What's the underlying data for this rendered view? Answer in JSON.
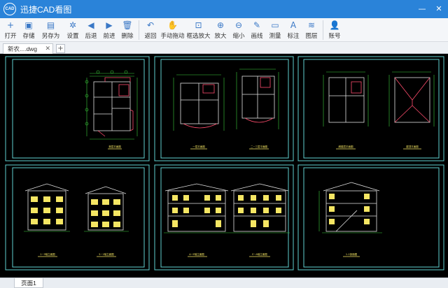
{
  "app": {
    "logo_text": "CAD",
    "title": "迅捷CAD看图"
  },
  "window_controls": {
    "minimize": "—",
    "close": "✕"
  },
  "toolbar": [
    {
      "id": "open",
      "label": "打开",
      "icon": "plus-icon",
      "glyph": "+"
    },
    {
      "id": "save",
      "label": "存储",
      "icon": "save-icon",
      "glyph": "▣"
    },
    {
      "id": "saveas",
      "label": "另存为",
      "icon": "save-as-icon",
      "glyph": "▤"
    },
    {
      "id": "settings",
      "label": "设置",
      "icon": "gear-icon",
      "glyph": "✲"
    },
    {
      "id": "back",
      "label": "后退",
      "icon": "back-arrow-icon",
      "glyph": "◀"
    },
    {
      "id": "forward",
      "label": "前进",
      "icon": "forward-arrow-icon",
      "glyph": "▶"
    },
    {
      "id": "delete",
      "label": "删除",
      "icon": "trash-icon",
      "glyph": "🗑"
    },
    {
      "id": "return",
      "label": "返回",
      "icon": "return-icon",
      "glyph": "↶"
    },
    {
      "id": "pan",
      "label": "手动拖动",
      "icon": "hand-icon",
      "glyph": "✋"
    },
    {
      "id": "zoomwin",
      "label": "框选放大",
      "icon": "zoom-window-icon",
      "glyph": "⊡"
    },
    {
      "id": "zoomin",
      "label": "放大",
      "icon": "zoom-in-icon",
      "glyph": "⊕"
    },
    {
      "id": "zoomout",
      "label": "缩小",
      "icon": "zoom-out-icon",
      "glyph": "⊖"
    },
    {
      "id": "line",
      "label": "画线",
      "icon": "pencil-icon",
      "glyph": "✎"
    },
    {
      "id": "measure",
      "label": "测量",
      "icon": "ruler-icon",
      "glyph": "▭"
    },
    {
      "id": "annotate",
      "label": "标注",
      "icon": "text-a-icon",
      "glyph": "A"
    },
    {
      "id": "layers",
      "label": "图层",
      "icon": "layers-icon",
      "glyph": "≋"
    },
    {
      "id": "account",
      "label": "账号",
      "icon": "user-icon",
      "glyph": "👤"
    }
  ],
  "tabs": {
    "document": "新农....dwg",
    "close": "✕",
    "add": "+"
  },
  "drawings": {
    "plan_1": "首层平面图",
    "plan_2": "一层平面图",
    "plan_3": "二~三层平面图",
    "plan_4": "阁楼层平面图",
    "plan_5": "屋顶平面图",
    "elev_1": "1~5轴立面图",
    "elev_2": "5~1轴立面图",
    "elev_3": "A~E轴立面图",
    "elev_4": "E~A轴立面图",
    "section_1": "1-1剖面图"
  },
  "page_tabs": {
    "page1": "页面1"
  },
  "colors": {
    "titlebar": "#2a83d9",
    "accent": "#3a78c6",
    "cad_frame": "#5fd1d1",
    "canvas": "#000000"
  }
}
